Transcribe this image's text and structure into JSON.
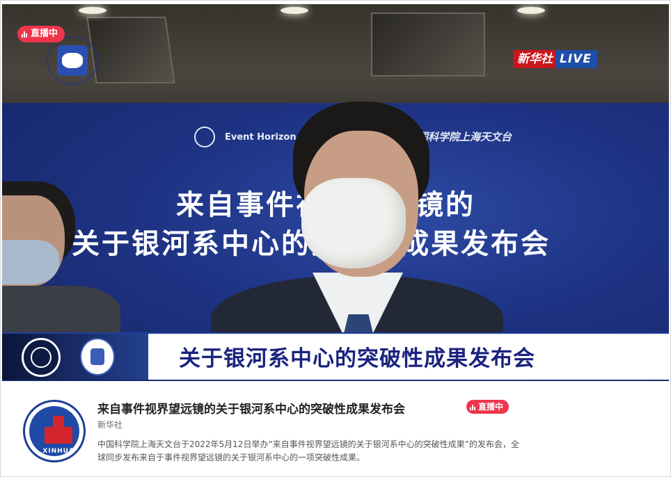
{
  "player": {
    "live_badge": "直播中",
    "broadcaster_logo": {
      "brand": "新华社",
      "tag": "LIVE",
      "red": "#c9161c",
      "blue": "#1e4ea8"
    },
    "backdrop": {
      "top_left_text": "Event Horizon T",
      "top_right_text": "中国科学院上海天文台",
      "line1": "来自事件视界望远镜的",
      "line2": "关于银河系中心的突破性成果发布会"
    },
    "banner_text": "关于银河系中心的突破性成果发布会"
  },
  "info": {
    "avatar_label": "XINHUA",
    "title": "来自事件视界望远镜的关于银河系中心的突破性成果发布会",
    "live_badge": "直播中",
    "source": "新华社",
    "description": "中国科学院上海天文台于2022年5月12日举办“来自事件视界望远镜的关于银河系中心的突破性成果”的发布会，全球同步发布来自于事件视界望远镜的关于银河系中心的一项突破性成果。"
  },
  "colors": {
    "live_red": "#f0344b",
    "banner_blue": "#1a237e"
  }
}
